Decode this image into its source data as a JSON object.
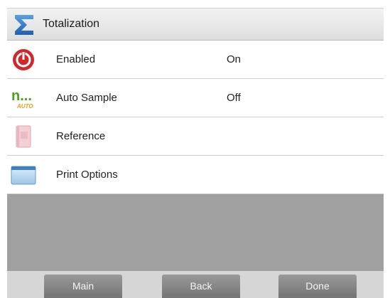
{
  "header": {
    "title": "Totalization",
    "icon": "sigma-icon"
  },
  "rows": [
    {
      "label": "Enabled",
      "value": "On",
      "icon": "power-icon"
    },
    {
      "label": "Auto Sample",
      "value": "Off",
      "icon": "auto-sample-icon",
      "icon_text": "n...",
      "icon_subtext": "AUTO"
    },
    {
      "label": "Reference",
      "value": "",
      "icon": "reference-book-icon"
    },
    {
      "label": "Print Options",
      "value": "",
      "icon": "print-options-icon"
    }
  ],
  "buttons": {
    "main": "Main",
    "back": "Back",
    "done": "Done"
  },
  "colors": {
    "header_bg": "#e6e6e6",
    "empty_area": "#a0a0a0",
    "button_bg": "#848484",
    "power_red": "#d0282a",
    "auto_green": "#4ea020"
  }
}
